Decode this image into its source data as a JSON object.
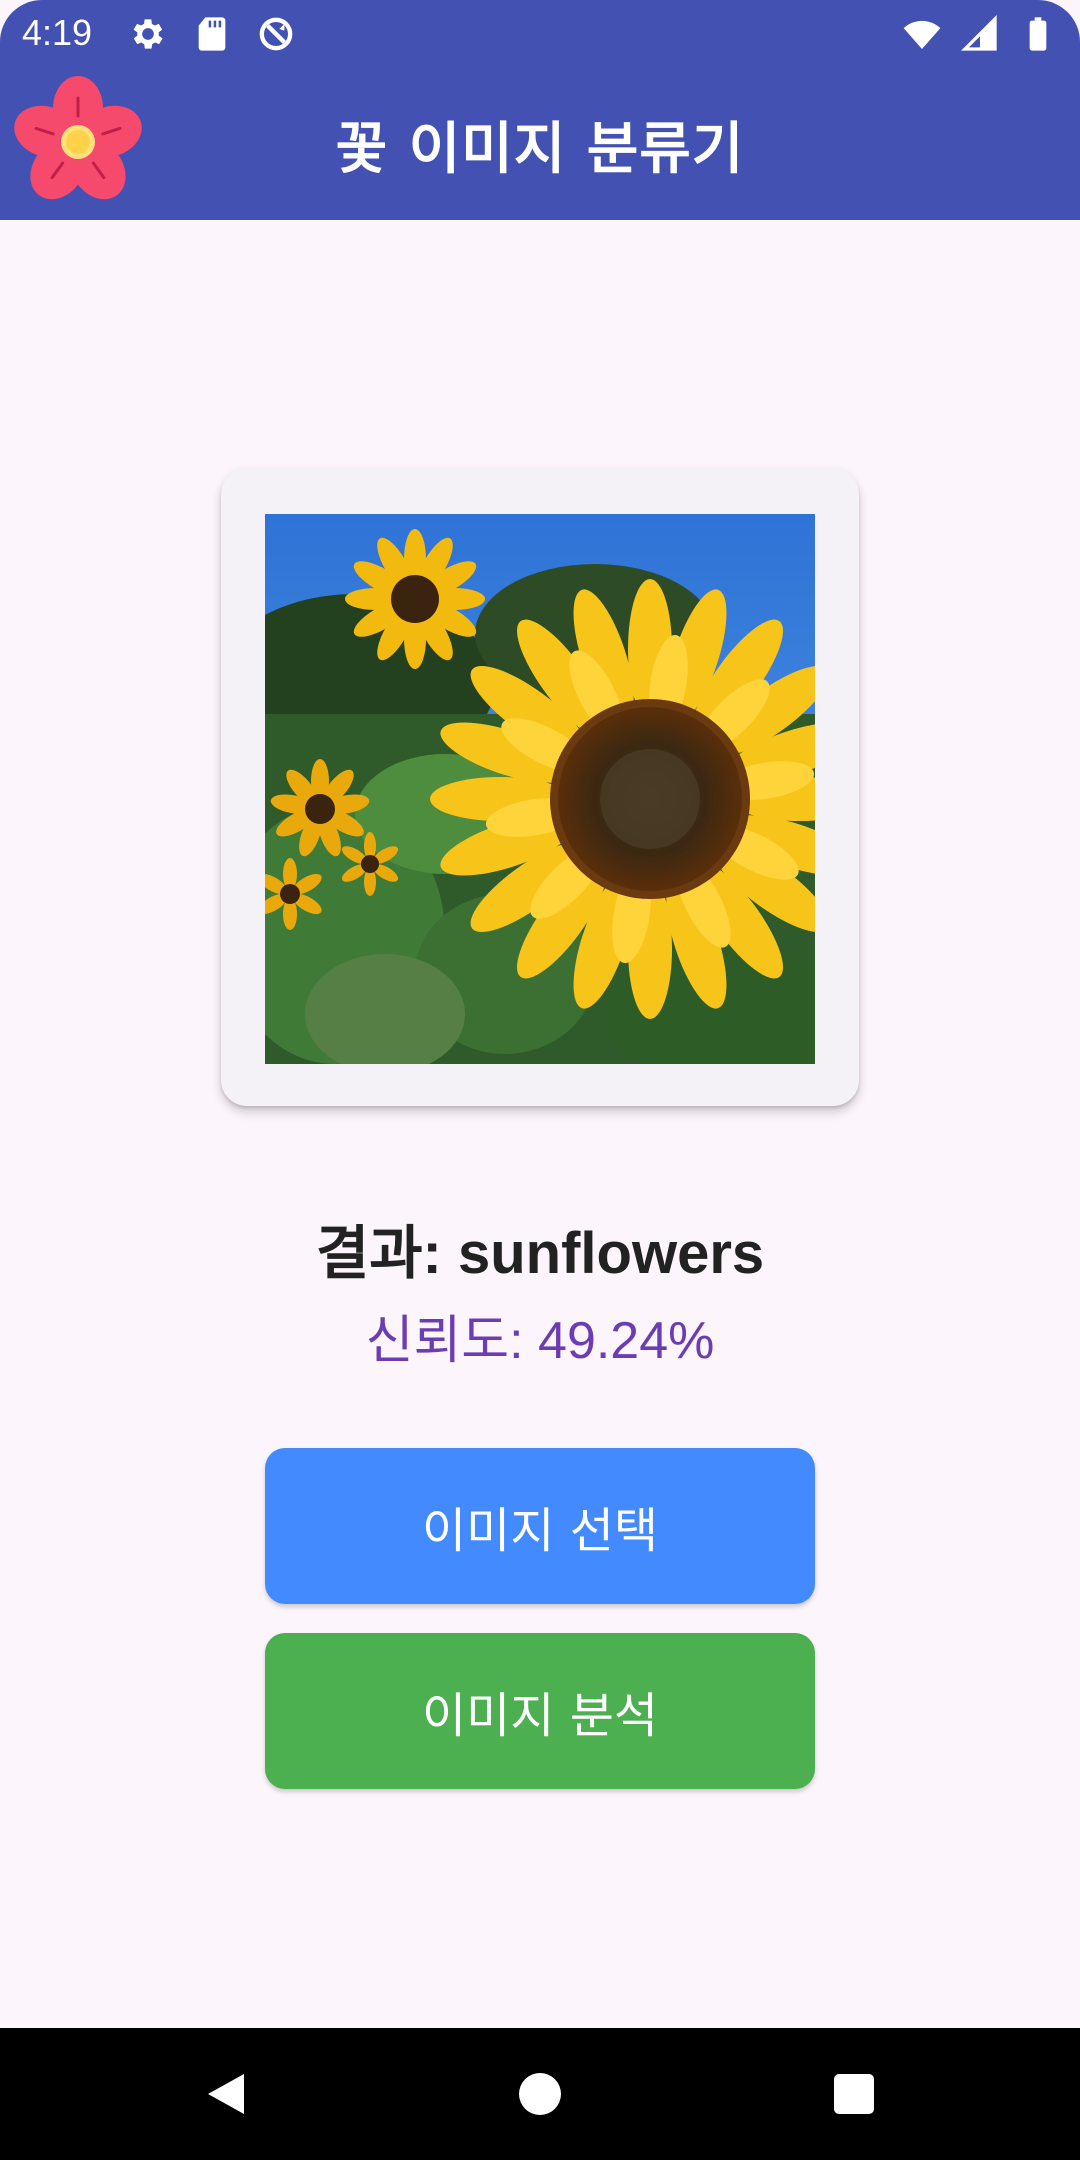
{
  "status_bar": {
    "time": "4:19",
    "left_icons": [
      "settings-icon",
      "sd-card-icon",
      "no-sync-icon"
    ],
    "right_icons": [
      "wifi-icon",
      "signal-icon",
      "battery-icon"
    ]
  },
  "app_bar": {
    "title": "꽃 이미지 분류기",
    "logo_icon": "flower-icon",
    "background_color": "#4351B3"
  },
  "image_preview": {
    "subject": "sunflowers photo"
  },
  "result": {
    "label": "결과: sunflowers",
    "confidence": "신뢰도: 49.24%",
    "confidence_color": "#6A3DB5"
  },
  "buttons": {
    "select_image": "이미지 선택",
    "select_color": "#448AFF",
    "analyze_image": "이미지 분석",
    "analyze_color": "#4CAF50"
  },
  "nav_bar": {
    "icons": [
      "back-icon",
      "home-icon",
      "recents-icon"
    ]
  }
}
